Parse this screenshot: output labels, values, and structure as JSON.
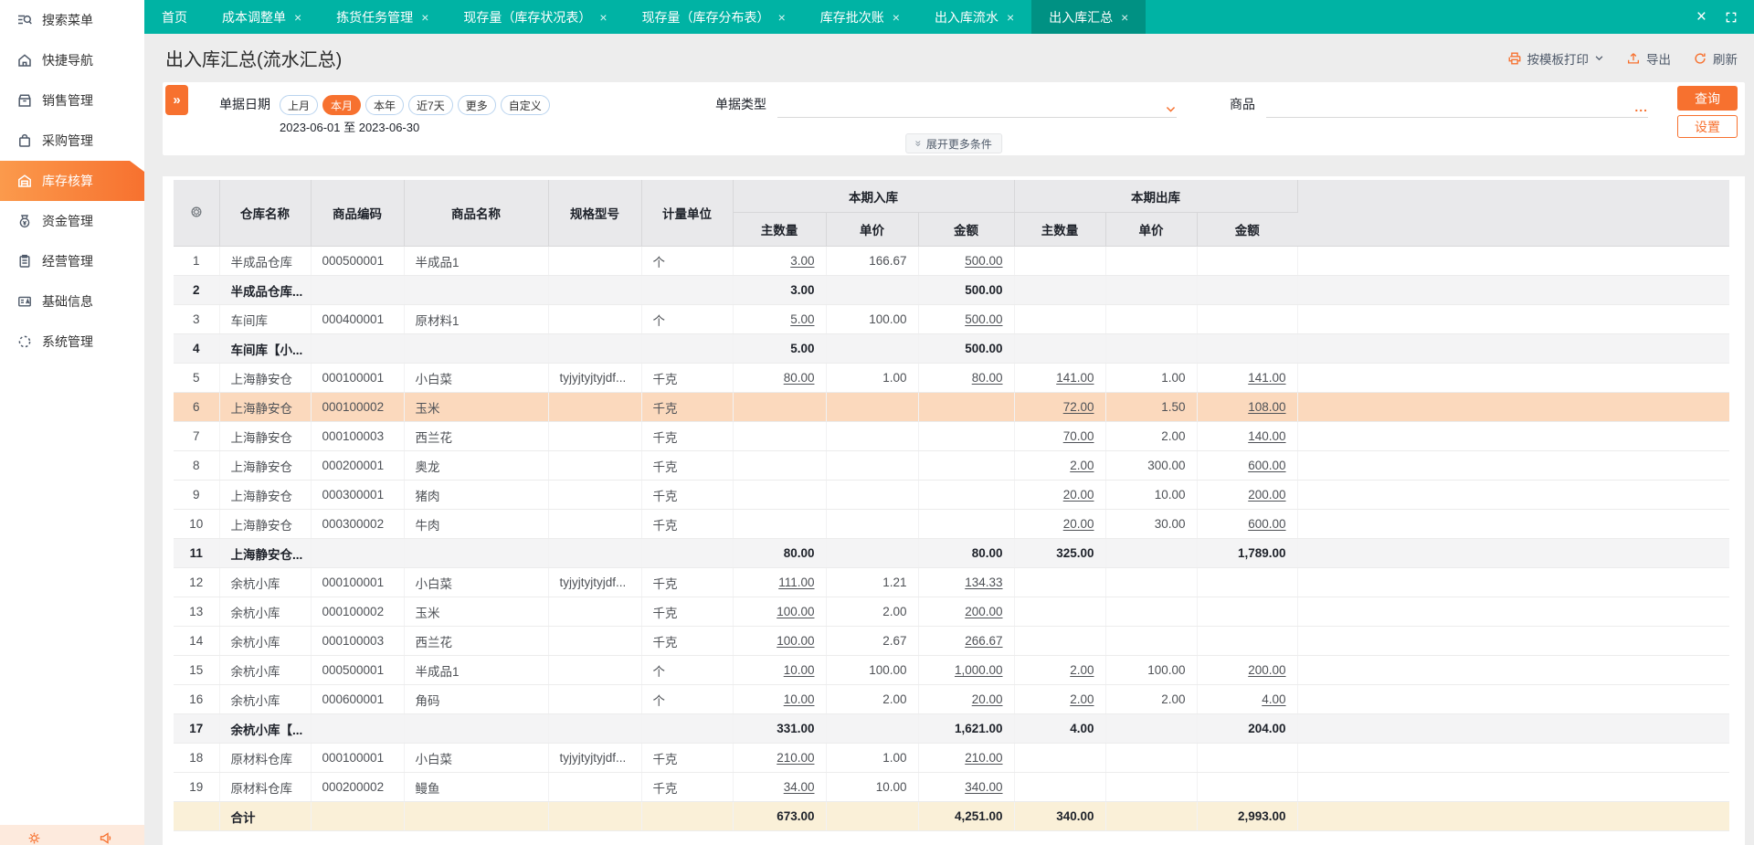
{
  "colors": {
    "accent": "#f7712f",
    "tabbar": "#00b3a4",
    "tab_active": "#009183",
    "row_highlight": "#fbd9bd",
    "row_subtotal": "#f4f4f5",
    "row_total": "#faf0d8"
  },
  "tabbar": {
    "tabs": [
      {
        "label": "首页",
        "closable": false,
        "active": false
      },
      {
        "label": "成本调整单",
        "closable": true,
        "active": false
      },
      {
        "label": "拣货任务管理",
        "closable": true,
        "active": false
      },
      {
        "label": "现存量（库存状况表）",
        "closable": true,
        "active": false
      },
      {
        "label": "现存量（库存分布表）",
        "closable": true,
        "active": false
      },
      {
        "label": "库存批次账",
        "closable": true,
        "active": false
      },
      {
        "label": "出入库流水",
        "closable": true,
        "active": false
      },
      {
        "label": "出入库汇总",
        "closable": true,
        "active": true
      }
    ],
    "close_glyph": "×",
    "window_close_glyph": "×"
  },
  "sidebar": {
    "items": [
      {
        "label": "搜索菜单",
        "icon": "search-menu-icon",
        "active": false
      },
      {
        "label": "快捷导航",
        "icon": "home-icon",
        "active": false
      },
      {
        "label": "销售管理",
        "icon": "sales-icon",
        "active": false
      },
      {
        "label": "采购管理",
        "icon": "purchase-bag-icon",
        "active": false
      },
      {
        "label": "库存核算",
        "icon": "warehouse-icon",
        "active": true
      },
      {
        "label": "资金管理",
        "icon": "money-bag-icon",
        "active": false
      },
      {
        "label": "经营管理",
        "icon": "clipboard-icon",
        "active": false
      },
      {
        "label": "基础信息",
        "icon": "id-card-icon",
        "active": false
      },
      {
        "label": "系统管理",
        "icon": "dashed-circle-icon",
        "active": false
      }
    ]
  },
  "header": {
    "title": "出入库汇总(流水汇总)",
    "toolbar": {
      "print": "按模板打印",
      "export": "导出",
      "refresh": "刷新"
    }
  },
  "filters": {
    "date_label": "单据日期",
    "date_options": [
      "上月",
      "本月",
      "本年",
      "近7天",
      "更多",
      "自定义"
    ],
    "active_date_option": "本月",
    "date_range": "2023-06-01 至 2023-06-30",
    "doc_type_label": "单据类型",
    "product_label": "商品",
    "product_ellipsis": "...",
    "search_button": "查询",
    "settings_button": "设置",
    "expand_more": "展开更多条件",
    "collapse_glyph": "»"
  },
  "table": {
    "columns": [
      "仓库名称",
      "商品编码",
      "商品名称",
      "规格型号",
      "计量单位"
    ],
    "group_headers": {
      "inbound": "本期入库",
      "outbound": "本期出库"
    },
    "sub_columns": [
      "主数量",
      "单价",
      "金额"
    ],
    "total_label": "合计",
    "rows": [
      {
        "num": "1",
        "type": "data",
        "highlighted": false,
        "warehouse": "半成品仓库",
        "code": "000500001",
        "name": "半成品1",
        "spec": "",
        "unit": "个",
        "in_qty": "3.00",
        "in_price": "166.67",
        "in_amt": "500.00",
        "out_qty": "",
        "out_price": "",
        "out_amt": ""
      },
      {
        "num": "2",
        "type": "subtotal",
        "highlighted": false,
        "warehouse": "半成品仓库...",
        "code": "",
        "name": "",
        "spec": "",
        "unit": "",
        "in_qty": "3.00",
        "in_price": "",
        "in_amt": "500.00",
        "out_qty": "",
        "out_price": "",
        "out_amt": ""
      },
      {
        "num": "3",
        "type": "data",
        "highlighted": false,
        "warehouse": "车间库",
        "code": "000400001",
        "name": "原材料1",
        "spec": "",
        "unit": "个",
        "in_qty": "5.00",
        "in_price": "100.00",
        "in_amt": "500.00",
        "out_qty": "",
        "out_price": "",
        "out_amt": ""
      },
      {
        "num": "4",
        "type": "subtotal",
        "highlighted": false,
        "warehouse": "车间库【小...",
        "code": "",
        "name": "",
        "spec": "",
        "unit": "",
        "in_qty": "5.00",
        "in_price": "",
        "in_amt": "500.00",
        "out_qty": "",
        "out_price": "",
        "out_amt": ""
      },
      {
        "num": "5",
        "type": "data",
        "highlighted": false,
        "warehouse": "上海静安仓",
        "code": "000100001",
        "name": "小白菜",
        "spec": "tyjyjtyjtyjdf...",
        "unit": "千克",
        "in_qty": "80.00",
        "in_price": "1.00",
        "in_amt": "80.00",
        "out_qty": "141.00",
        "out_price": "1.00",
        "out_amt": "141.00"
      },
      {
        "num": "6",
        "type": "data",
        "highlighted": true,
        "warehouse": "上海静安仓",
        "code": "000100002",
        "name": "玉米",
        "spec": "",
        "unit": "千克",
        "in_qty": "",
        "in_price": "",
        "in_amt": "",
        "out_qty": "72.00",
        "out_price": "1.50",
        "out_amt": "108.00"
      },
      {
        "num": "7",
        "type": "data",
        "highlighted": false,
        "warehouse": "上海静安仓",
        "code": "000100003",
        "name": "西兰花",
        "spec": "",
        "unit": "千克",
        "in_qty": "",
        "in_price": "",
        "in_amt": "",
        "out_qty": "70.00",
        "out_price": "2.00",
        "out_amt": "140.00"
      },
      {
        "num": "8",
        "type": "data",
        "highlighted": false,
        "warehouse": "上海静安仓",
        "code": "000200001",
        "name": "奥龙",
        "spec": "",
        "unit": "千克",
        "in_qty": "",
        "in_price": "",
        "in_amt": "",
        "out_qty": "2.00",
        "out_price": "300.00",
        "out_amt": "600.00"
      },
      {
        "num": "9",
        "type": "data",
        "highlighted": false,
        "warehouse": "上海静安仓",
        "code": "000300001",
        "name": "猪肉",
        "spec": "",
        "unit": "千克",
        "in_qty": "",
        "in_price": "",
        "in_amt": "",
        "out_qty": "20.00",
        "out_price": "10.00",
        "out_amt": "200.00"
      },
      {
        "num": "10",
        "type": "data",
        "highlighted": false,
        "warehouse": "上海静安仓",
        "code": "000300002",
        "name": "牛肉",
        "spec": "",
        "unit": "千克",
        "in_qty": "",
        "in_price": "",
        "in_amt": "",
        "out_qty": "20.00",
        "out_price": "30.00",
        "out_amt": "600.00"
      },
      {
        "num": "11",
        "type": "subtotal",
        "highlighted": false,
        "warehouse": "上海静安仓...",
        "code": "",
        "name": "",
        "spec": "",
        "unit": "",
        "in_qty": "80.00",
        "in_price": "",
        "in_amt": "80.00",
        "out_qty": "325.00",
        "out_price": "",
        "out_amt": "1,789.00"
      },
      {
        "num": "12",
        "type": "data",
        "highlighted": false,
        "warehouse": "余杭小库",
        "code": "000100001",
        "name": "小白菜",
        "spec": "tyjyjtyjtyjdf...",
        "unit": "千克",
        "in_qty": "111.00",
        "in_price": "1.21",
        "in_amt": "134.33",
        "out_qty": "",
        "out_price": "",
        "out_amt": ""
      },
      {
        "num": "13",
        "type": "data",
        "highlighted": false,
        "warehouse": "余杭小库",
        "code": "000100002",
        "name": "玉米",
        "spec": "",
        "unit": "千克",
        "in_qty": "100.00",
        "in_price": "2.00",
        "in_amt": "200.00",
        "out_qty": "",
        "out_price": "",
        "out_amt": ""
      },
      {
        "num": "14",
        "type": "data",
        "highlighted": false,
        "warehouse": "余杭小库",
        "code": "000100003",
        "name": "西兰花",
        "spec": "",
        "unit": "千克",
        "in_qty": "100.00",
        "in_price": "2.67",
        "in_amt": "266.67",
        "out_qty": "",
        "out_price": "",
        "out_amt": ""
      },
      {
        "num": "15",
        "type": "data",
        "highlighted": false,
        "warehouse": "余杭小库",
        "code": "000500001",
        "name": "半成品1",
        "spec": "",
        "unit": "个",
        "in_qty": "10.00",
        "in_price": "100.00",
        "in_amt": "1,000.00",
        "out_qty": "2.00",
        "out_price": "100.00",
        "out_amt": "200.00"
      },
      {
        "num": "16",
        "type": "data",
        "highlighted": false,
        "warehouse": "余杭小库",
        "code": "000600001",
        "name": "角码",
        "spec": "",
        "unit": "个",
        "in_qty": "10.00",
        "in_price": "2.00",
        "in_amt": "20.00",
        "out_qty": "2.00",
        "out_price": "2.00",
        "out_amt": "4.00"
      },
      {
        "num": "17",
        "type": "subtotal",
        "highlighted": false,
        "warehouse": "余杭小库【...",
        "code": "",
        "name": "",
        "spec": "",
        "unit": "",
        "in_qty": "331.00",
        "in_price": "",
        "in_amt": "1,621.00",
        "out_qty": "4.00",
        "out_price": "",
        "out_amt": "204.00"
      },
      {
        "num": "18",
        "type": "data",
        "highlighted": false,
        "warehouse": "原材料仓库",
        "code": "000100001",
        "name": "小白菜",
        "spec": "tyjyjtyjtyjdf...",
        "unit": "千克",
        "in_qty": "210.00",
        "in_price": "1.00",
        "in_amt": "210.00",
        "out_qty": "",
        "out_price": "",
        "out_amt": ""
      },
      {
        "num": "19",
        "type": "data",
        "highlighted": false,
        "warehouse": "原材料仓库",
        "code": "000200002",
        "name": "鳗鱼",
        "spec": "",
        "unit": "千克",
        "in_qty": "34.00",
        "in_price": "10.00",
        "in_amt": "340.00",
        "out_qty": "",
        "out_price": "",
        "out_amt": ""
      },
      {
        "num": "",
        "type": "total",
        "highlighted": false,
        "warehouse": "合计",
        "code": "",
        "name": "",
        "spec": "",
        "unit": "",
        "in_qty": "673.00",
        "in_price": "",
        "in_amt": "4,251.00",
        "out_qty": "340.00",
        "out_price": "",
        "out_amt": "2,993.00"
      }
    ]
  }
}
